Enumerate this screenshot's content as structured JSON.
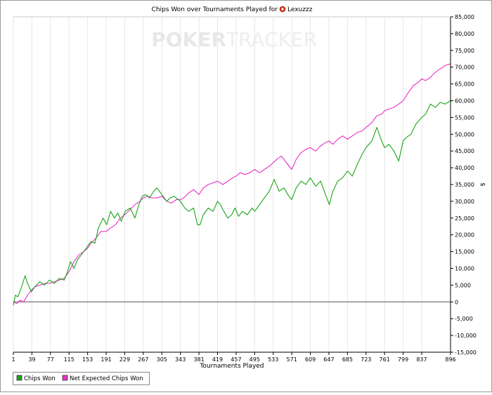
{
  "chart_data": {
    "type": "line",
    "title": "Chips Won over Tournaments Played for",
    "player": "Lexuzzz",
    "watermark": {
      "left": "POKER",
      "right": "TRACKER"
    },
    "xlabel": "Tournaments Played",
    "ylabel": "$",
    "xlim": [
      1,
      896
    ],
    "ylim": [
      -15000,
      85000
    ],
    "x_ticks": [
      1,
      39,
      77,
      115,
      153,
      191,
      229,
      267,
      305,
      343,
      381,
      419,
      457,
      495,
      533,
      571,
      609,
      647,
      685,
      723,
      761,
      799,
      837,
      896
    ],
    "y_ticks": [
      {
        "value": 85000,
        "label": "85,000"
      },
      {
        "value": 80000,
        "label": "80,000"
      },
      {
        "value": 75000,
        "label": "75,000"
      },
      {
        "value": 70000,
        "label": "70,000"
      },
      {
        "value": 65000,
        "label": "65,000"
      },
      {
        "value": 60000,
        "label": "60,000"
      },
      {
        "value": 55000,
        "label": "55,000"
      },
      {
        "value": 50000,
        "label": "50,000"
      },
      {
        "value": 45000,
        "label": "45,000"
      },
      {
        "value": 40000,
        "label": "40,000"
      },
      {
        "value": 35000,
        "label": "35,000"
      },
      {
        "value": 30000,
        "label": "30,000"
      },
      {
        "value": 25000,
        "label": "25,000"
      },
      {
        "value": 20000,
        "label": "20,000"
      },
      {
        "value": 15000,
        "label": "15,000"
      },
      {
        "value": 10000,
        "label": "10,000"
      },
      {
        "value": 5000,
        "label": "5,000"
      },
      {
        "value": 0,
        "label": "0"
      },
      {
        "value": -5000,
        "label": "-5,000"
      },
      {
        "value": -10000,
        "label": "-10,000"
      },
      {
        "value": -15000,
        "label": "-15,000"
      }
    ],
    "grid": "vertical",
    "legend_position": "bottom-left",
    "series": [
      {
        "name": "Chips Won",
        "color": "#1aa51a",
        "x": [
          1,
          5,
          10,
          18,
          25,
          30,
          38,
          45,
          55,
          65,
          75,
          85,
          95,
          105,
          112,
          118,
          125,
          132,
          140,
          150,
          160,
          168,
          175,
          185,
          192,
          200,
          208,
          215,
          222,
          230,
          240,
          250,
          258,
          265,
          272,
          280,
          288,
          295,
          305,
          315,
          322,
          330,
          343,
          352,
          360,
          370,
          378,
          383,
          390,
          400,
          410,
          419,
          425,
          432,
          440,
          448,
          455,
          462,
          470,
          480,
          490,
          495,
          505,
          515,
          525,
          535,
          545,
          555,
          565,
          571,
          580,
          590,
          600,
          609,
          620,
          630,
          640,
          648,
          655,
          665,
          675,
          685,
          695,
          705,
          715,
          723,
          735,
          745,
          755,
          761,
          770,
          780,
          790,
          799,
          805,
          815,
          825,
          837,
          845,
          855,
          865,
          875,
          885,
          896
        ],
        "y": [
          -1000,
          2000,
          1500,
          4500,
          7800,
          5500,
          3000,
          4500,
          6000,
          5000,
          6500,
          5500,
          7000,
          6500,
          9000,
          12000,
          10000,
          12500,
          14000,
          16000,
          18000,
          17500,
          22000,
          25000,
          23000,
          27000,
          25000,
          26500,
          24000,
          27000,
          28000,
          25000,
          29000,
          31500,
          32000,
          31000,
          33000,
          34000,
          32000,
          30000,
          31000,
          31500,
          30000,
          28000,
          27000,
          28000,
          23000,
          23000,
          26000,
          28000,
          27000,
          30000,
          29000,
          27000,
          25000,
          26000,
          28000,
          25500,
          27000,
          26000,
          28000,
          27000,
          29000,
          31000,
          33000,
          36500,
          33000,
          34000,
          31500,
          30500,
          34000,
          36000,
          35000,
          37000,
          34500,
          36000,
          32000,
          29000,
          33000,
          36000,
          37000,
          39000,
          37500,
          41000,
          44000,
          46000,
          48000,
          52000,
          48000,
          46000,
          47000,
          45000,
          42000,
          48000,
          49000,
          50000,
          53000,
          55000,
          56000,
          59000,
          58000,
          59500,
          59000,
          60000
        ]
      },
      {
        "name": "Net Expected Chips Won",
        "color": "#e830c8",
        "x": [
          1,
          8,
          15,
          22,
          30,
          38,
          45,
          55,
          65,
          75,
          85,
          95,
          105,
          115,
          125,
          135,
          145,
          153,
          160,
          170,
          180,
          191,
          200,
          210,
          220,
          229,
          240,
          250,
          260,
          267,
          275,
          285,
          295,
          305,
          315,
          325,
          335,
          343,
          350,
          360,
          370,
          381,
          390,
          400,
          410,
          419,
          430,
          440,
          450,
          457,
          465,
          475,
          485,
          495,
          505,
          515,
          525,
          533,
          540,
          550,
          560,
          571,
          580,
          590,
          600,
          609,
          620,
          630,
          640,
          647,
          655,
          665,
          675,
          685,
          695,
          705,
          715,
          723,
          735,
          745,
          755,
          761,
          770,
          780,
          790,
          799,
          810,
          820,
          830,
          837,
          845,
          855,
          865,
          875,
          885,
          896
        ],
        "y": [
          0,
          -500,
          500,
          0,
          2000,
          3500,
          4500,
          5000,
          5500,
          5500,
          6000,
          6500,
          7000,
          9000,
          12000,
          14000,
          15000,
          16000,
          17500,
          19000,
          21000,
          21000,
          22000,
          23000,
          25000,
          26000,
          27500,
          29000,
          30000,
          31000,
          31500,
          31000,
          31000,
          31500,
          30000,
          29500,
          30500,
          30500,
          31000,
          32500,
          33500,
          32000,
          34000,
          35000,
          35500,
          36000,
          35000,
          36000,
          37000,
          37500,
          38500,
          38000,
          38500,
          39500,
          38500,
          39500,
          40500,
          41500,
          42500,
          43500,
          41500,
          39500,
          42500,
          44500,
          45500,
          46000,
          45000,
          46500,
          47500,
          48000,
          47000,
          48500,
          49500,
          48500,
          49500,
          50500,
          51000,
          52000,
          53500,
          55500,
          56000,
          57000,
          57500,
          58000,
          59000,
          60000,
          62500,
          64500,
          65500,
          66500,
          66000,
          67000,
          68500,
          69500,
          70500,
          71000
        ]
      }
    ]
  }
}
